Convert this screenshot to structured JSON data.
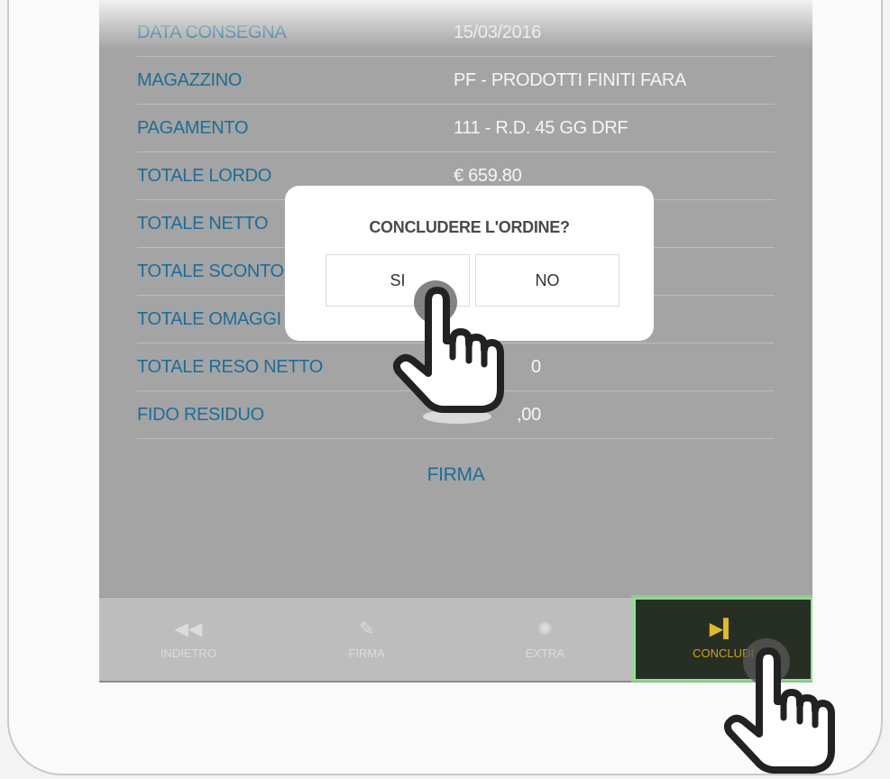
{
  "summary": [
    {
      "label": "DATA CONSEGNA",
      "value": "15/03/2016"
    },
    {
      "label": "MAGAZZINO",
      "value": "PF - PRODOTTI FINITI FARA"
    },
    {
      "label": "PAGAMENTO",
      "value": "111 - R.D. 45 GG DRF"
    },
    {
      "label": "TOTALE LORDO",
      "value": "€ 659.80"
    },
    {
      "label": "TOTALE NETTO",
      "value": ""
    },
    {
      "label": "TOTALE SCONTO",
      "value": ""
    },
    {
      "label": "TOTALE OMAGGI",
      "value": ""
    },
    {
      "label": "TOTALE RESO NETTO",
      "value": "0"
    },
    {
      "label": "FIDO RESIDUO",
      "value": ",00"
    }
  ],
  "firma_link": "FIRMA",
  "toolbar": {
    "indietro": {
      "label": "INDIETRO",
      "icon": "rewind-icon"
    },
    "firma": {
      "label": "FIRMA",
      "icon": "pencil-icon"
    },
    "extra": {
      "label": "EXTRA",
      "icon": "lightbulb-icon"
    },
    "concludi": {
      "label": "CONCLUDI",
      "icon": "skip-end-icon"
    }
  },
  "dialog": {
    "title": "CONCLUDERE L'ORDINE?",
    "yes_label": "SI",
    "no_label": "NO"
  },
  "colors": {
    "label": "#1c6e97",
    "overlay": "#a4a4a4",
    "active_button": "#272f24",
    "active_text": "#c9a21b"
  }
}
